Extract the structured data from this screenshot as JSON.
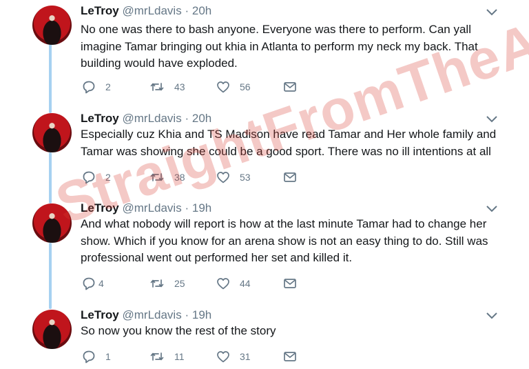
{
  "watermark": "StraightFromTheA.com",
  "tweets": [
    {
      "name": "LeTroy",
      "handle": "@mrLdavis",
      "dot": "·",
      "time": "20h",
      "text": "No one was there to bash anyone. Everyone was there to perform. Can yall imagine Tamar bringing out khia in Atlanta to perform my neck my back. That building would have exploded.",
      "replies": "2",
      "retweets": "43",
      "likes": "56"
    },
    {
      "name": "LeTroy",
      "handle": "@mrLdavis",
      "dot": "·",
      "time": "20h",
      "text": "Especially cuz Khia and TS Madison have read Tamar and Her whole family and Tamar was showing she could be a good sport. There was no ill intentions at all",
      "replies": "2",
      "retweets": "38",
      "likes": "53"
    },
    {
      "name": "LeTroy",
      "handle": "@mrLdavis",
      "dot": "·",
      "time": "19h",
      "text": "And what nobody will report is how at the last minute Tamar had to change her show. Which if you know for an arena show is not an easy thing to do. Still was professional went out performed her set and killed it.",
      "replies": "4",
      "retweets": "25",
      "likes": "44"
    },
    {
      "name": "LeTroy",
      "handle": "@mrLdavis",
      "dot": "·",
      "time": "19h",
      "text": "So now you know the rest of the story",
      "replies": "1",
      "retweets": "11",
      "likes": "31"
    }
  ]
}
